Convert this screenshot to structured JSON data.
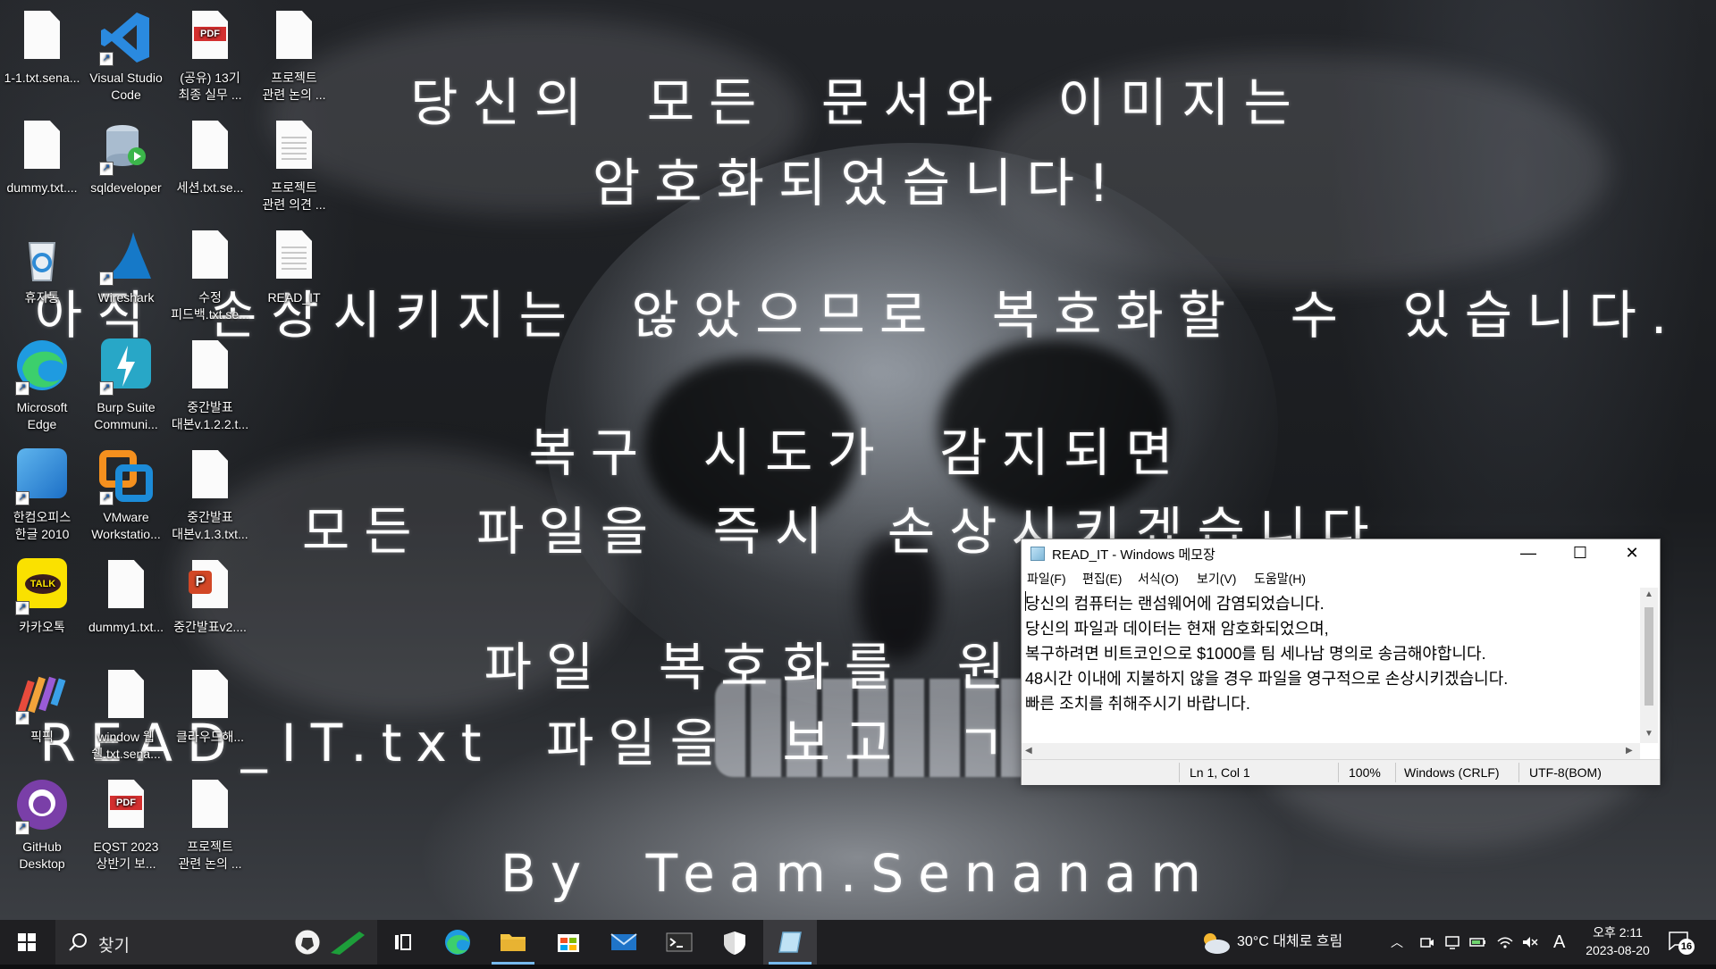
{
  "wallpaper": {
    "lines": [
      "당신의 모든 문서와 이미지는",
      "암호화되었습니다!",
      "아직 손상시키지는 않았으므로 복호화할 수 있습니다.",
      "복구 시도가 감지되면",
      "모든 파일을 즉시 손상시키겠습니다.",
      "파일 복호화를 원",
      "READ_IT.txt 파일을 보고 ㄱ",
      "By Team.Senanam"
    ]
  },
  "desktop": {
    "icons": [
      {
        "name": "text-file-icon",
        "label1": "1-1.txt.sena...",
        "label2": ""
      },
      {
        "name": "text-file-icon",
        "label1": "dummy.txt....",
        "label2": ""
      },
      {
        "name": "recycle-bin-icon",
        "label1": "휴지통",
        "label2": ""
      },
      {
        "name": "edge-icon",
        "label1": "Microsoft",
        "label2": "Edge"
      },
      {
        "name": "hancom-office-icon",
        "label1": "한컴오피스",
        "label2": "한글 2010"
      },
      {
        "name": "kakaotalk-icon",
        "label1": "카카오톡",
        "label2": ""
      },
      {
        "name": "picpick-icon",
        "label1": "픽픽",
        "label2": ""
      },
      {
        "name": "github-desktop-icon",
        "label1": "GitHub",
        "label2": "Desktop"
      },
      {
        "name": "vscode-icon",
        "label1": "Visual Studio",
        "label2": "Code"
      },
      {
        "name": "sqldeveloper-icon",
        "label1": "sqldeveloper",
        "label2": ""
      },
      {
        "name": "wireshark-icon",
        "label1": "Wireshark",
        "label2": ""
      },
      {
        "name": "burp-suite-icon",
        "label1": "Burp Suite",
        "label2": "Communi..."
      },
      {
        "name": "vmware-icon",
        "label1": "VMware",
        "label2": "Workstatio..."
      },
      {
        "name": "text-file-icon",
        "label1": "dummy1.txt...",
        "label2": ""
      },
      {
        "name": "text-file-icon",
        "label1": "window 웹",
        "label2": "쉘.txt.sena..."
      },
      {
        "name": "pdf-file-icon",
        "label1": "EQST 2023",
        "label2": "상반기 보..."
      },
      {
        "name": "pdf-file-icon",
        "label1": "(공유) 13기",
        "label2": "최종 실무 ..."
      },
      {
        "name": "text-file-icon",
        "label1": "세션.txt.se...",
        "label2": ""
      },
      {
        "name": "text-file-icon",
        "label1": "수정",
        "label2": "피드백.txt.se..."
      },
      {
        "name": "text-file-icon",
        "label1": "중간발표",
        "label2": "대본v.1.2.2.t..."
      },
      {
        "name": "text-file-icon",
        "label1": "중간발표",
        "label2": "대본v.1.3.txt..."
      },
      {
        "name": "powerpoint-file-icon",
        "label1": "중간발표v2....",
        "label2": ""
      },
      {
        "name": "text-file-icon",
        "label1": "클라우드해...",
        "label2": ""
      },
      {
        "name": "text-file-icon",
        "label1": "프로젝트",
        "label2": "관련 논의 ..."
      },
      {
        "name": "text-file-icon",
        "label1": "프로젝트",
        "label2": "관련 논의 ..."
      },
      {
        "name": "text-file-icon",
        "label1": "프로젝트",
        "label2": "관련 의견 ..."
      },
      {
        "name": "text-file-icon",
        "label1": "READ_IT",
        "label2": ""
      }
    ],
    "pdf_badge": "PDF",
    "kakao_badge": "TALK"
  },
  "notepad": {
    "title": "READ_IT - Windows 메모장",
    "controls": {
      "minimize": "—",
      "maximize": "☐",
      "close": "✕"
    },
    "menu": [
      "파일(F)",
      "편집(E)",
      "서식(O)",
      "보기(V)",
      "도움말(H)"
    ],
    "lines": [
      "당신의 컴퓨터는 랜섬웨어에 감염되었습니다.",
      "당신의 파일과 데이터는 현재 암호화되었으며,",
      "복구하려면 비트코인으로 $1000를 팀 세나남 명의로 송금해야합니다.",
      "48시간 이내에 지불하지 않을 경우 파일을 영구적으로 손상시키겠습니다.",
      "빠른 조치를 취해주시기 바랍니다."
    ],
    "status": {
      "position": "Ln 1, Col 1",
      "zoom": "100%",
      "line_ending": "Windows (CRLF)",
      "encoding": "UTF-8(BOM)"
    }
  },
  "taskbar": {
    "search_label": "찾기",
    "weather": "30°C  대체로 흐림",
    "ime": "A",
    "time": "오후 2:11",
    "date": "2023-08-20",
    "notifications": "16",
    "colors": {
      "background": "#1f1f22",
      "active_indicator": "#76b9ed"
    }
  }
}
